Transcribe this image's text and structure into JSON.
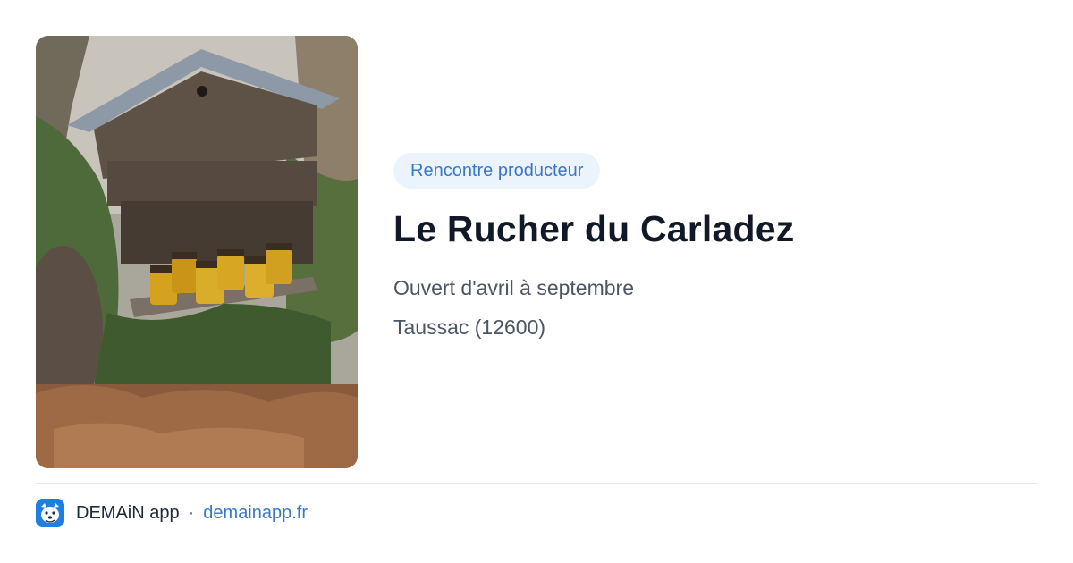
{
  "card": {
    "badge": "Rencontre producteur",
    "title": "Le Rucher du Carladez",
    "opening": "Ouvert d'avril à septembre",
    "location": "Taussac (12600)"
  },
  "photo": {
    "subject": "beehive-with-honey-jars"
  },
  "footer": {
    "app_name": "DEMAiN app",
    "separator": "·",
    "url": "demainapp.fr",
    "logo_icon": "dog-face-icon"
  },
  "colors": {
    "accent": "#3a78c7",
    "badge_bg": "#ebf3fd",
    "title": "#111827",
    "text": "#4b5563",
    "logo_bg": "#1f7fe0",
    "divider": "#e3e9ed"
  }
}
